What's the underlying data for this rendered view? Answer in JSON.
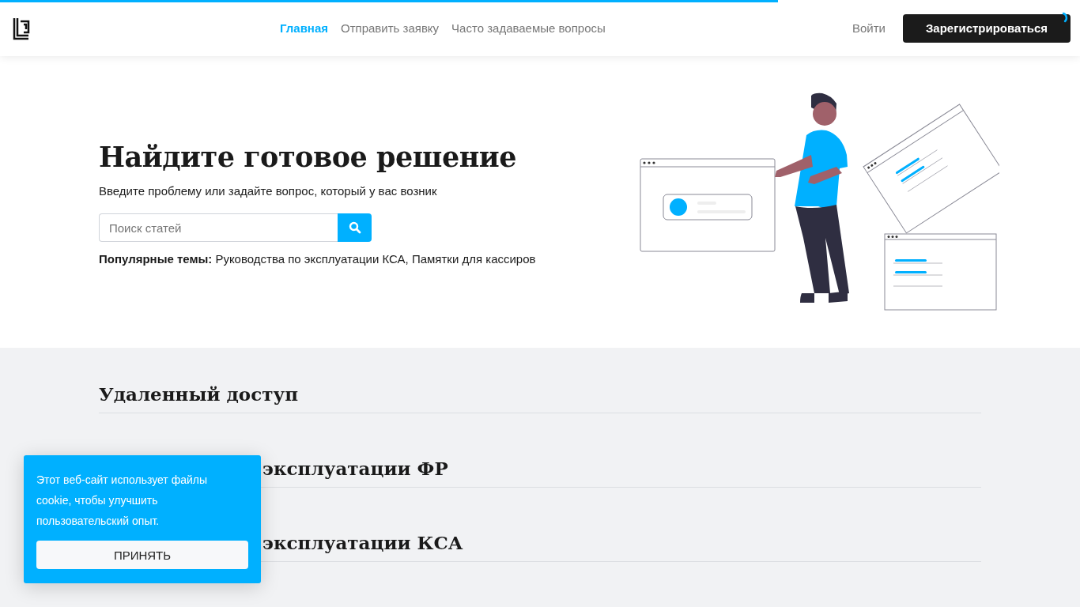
{
  "progress": {
    "level": 0.72
  },
  "header": {
    "nav": [
      {
        "label": "Главная",
        "selected": true
      },
      {
        "label": "Отправить заявку",
        "selected": false
      },
      {
        "label": "Часто задаваемые вопросы",
        "selected": false
      }
    ],
    "login": "Войти",
    "register": "Зарегистрироваться"
  },
  "hero": {
    "title": "Найдите готовое решение",
    "subtitle": "Введите проблему или задайте вопрос, который у вас возник",
    "search": {
      "placeholder": "Поиск статей"
    },
    "popular_label": "Популярные темы:",
    "popular_topics": "Руководства по эксплуатации КСА, Памятки для кассиров"
  },
  "sections": [
    {
      "title": "Удаленный доступ",
      "kind": "full"
    },
    {
      "title": "эксплуатации ФР",
      "kind": "partial"
    },
    {
      "title": "эксплуатации КСА",
      "kind": "partial"
    }
  ],
  "cookie": {
    "text": "Этот веб-сайт использует файлы cookie, чтобы улучшить пользовательский опыт.",
    "button": "ПРИНЯТЬ"
  }
}
